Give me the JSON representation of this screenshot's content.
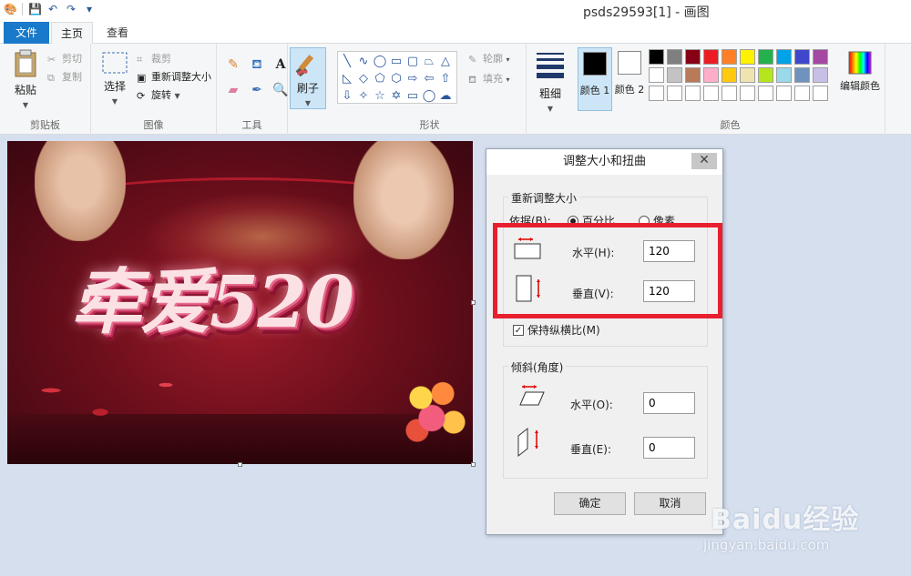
{
  "window": {
    "title": "psds29593[1] - 画图"
  },
  "quick_access": {
    "icons": [
      "paint-app-icon",
      "save-icon",
      "undo-icon",
      "redo-icon",
      "customize-qat-icon"
    ]
  },
  "tabs": [
    {
      "label": "文件"
    },
    {
      "label": "主页"
    },
    {
      "label": "查看"
    }
  ],
  "ribbon": {
    "clipboard": {
      "paste": "粘贴",
      "cut": "剪切",
      "copy": "复制",
      "group": "剪贴板"
    },
    "image": {
      "select": "选择",
      "crop": "裁剪",
      "resize": "重新调整大小",
      "rotate": "旋转",
      "group": "图像"
    },
    "tools": {
      "group": "工具"
    },
    "brushes": {
      "label": "刷子"
    },
    "shapes": {
      "outline": "轮廓",
      "fill": "填充",
      "group": "形状"
    },
    "size": {
      "label": "粗细"
    },
    "colors": {
      "color1": "颜色 1",
      "color2": "颜色 2",
      "edit": "编辑颜色",
      "group": "颜色",
      "color1_value": "#000000",
      "color2_value": "#ffffff",
      "palette": [
        "#000000",
        "#7f7f7f",
        "#880015",
        "#ed1c24",
        "#ff7f27",
        "#fff200",
        "#22b14c",
        "#00a2e8",
        "#3f48cc",
        "#a349a4",
        "#ffffff",
        "#c3c3c3",
        "#b97a57",
        "#ffaec9",
        "#ffc90e",
        "#efe4b0",
        "#b5e61d",
        "#99d9ea",
        "#7092be",
        "#c8bfe7",
        "#ffffff",
        "#ffffff",
        "#ffffff",
        "#ffffff",
        "#ffffff",
        "#ffffff",
        "#ffffff",
        "#ffffff",
        "#ffffff",
        "#ffffff"
      ]
    }
  },
  "canvas": {
    "image_text": "牵爱520"
  },
  "dialog": {
    "title": "调整大小和扭曲",
    "resize": {
      "legend": "重新调整大小",
      "by_label": "依据(B):",
      "percent": "百分比",
      "pixels": "像素",
      "horizontal_label": "水平(H):",
      "horizontal_value": "120",
      "vertical_label": "垂直(V):",
      "vertical_value": "120",
      "keep_ratio": "保持纵横比(M)"
    },
    "skew": {
      "legend": "倾斜(角度)",
      "horizontal_label": "水平(O):",
      "horizontal_value": "0",
      "vertical_label": "垂直(E):",
      "vertical_value": "0"
    },
    "ok": "确定",
    "cancel": "取消"
  },
  "watermark": {
    "main": "Baidu经验",
    "sub": "jingyan.baidu.com"
  }
}
